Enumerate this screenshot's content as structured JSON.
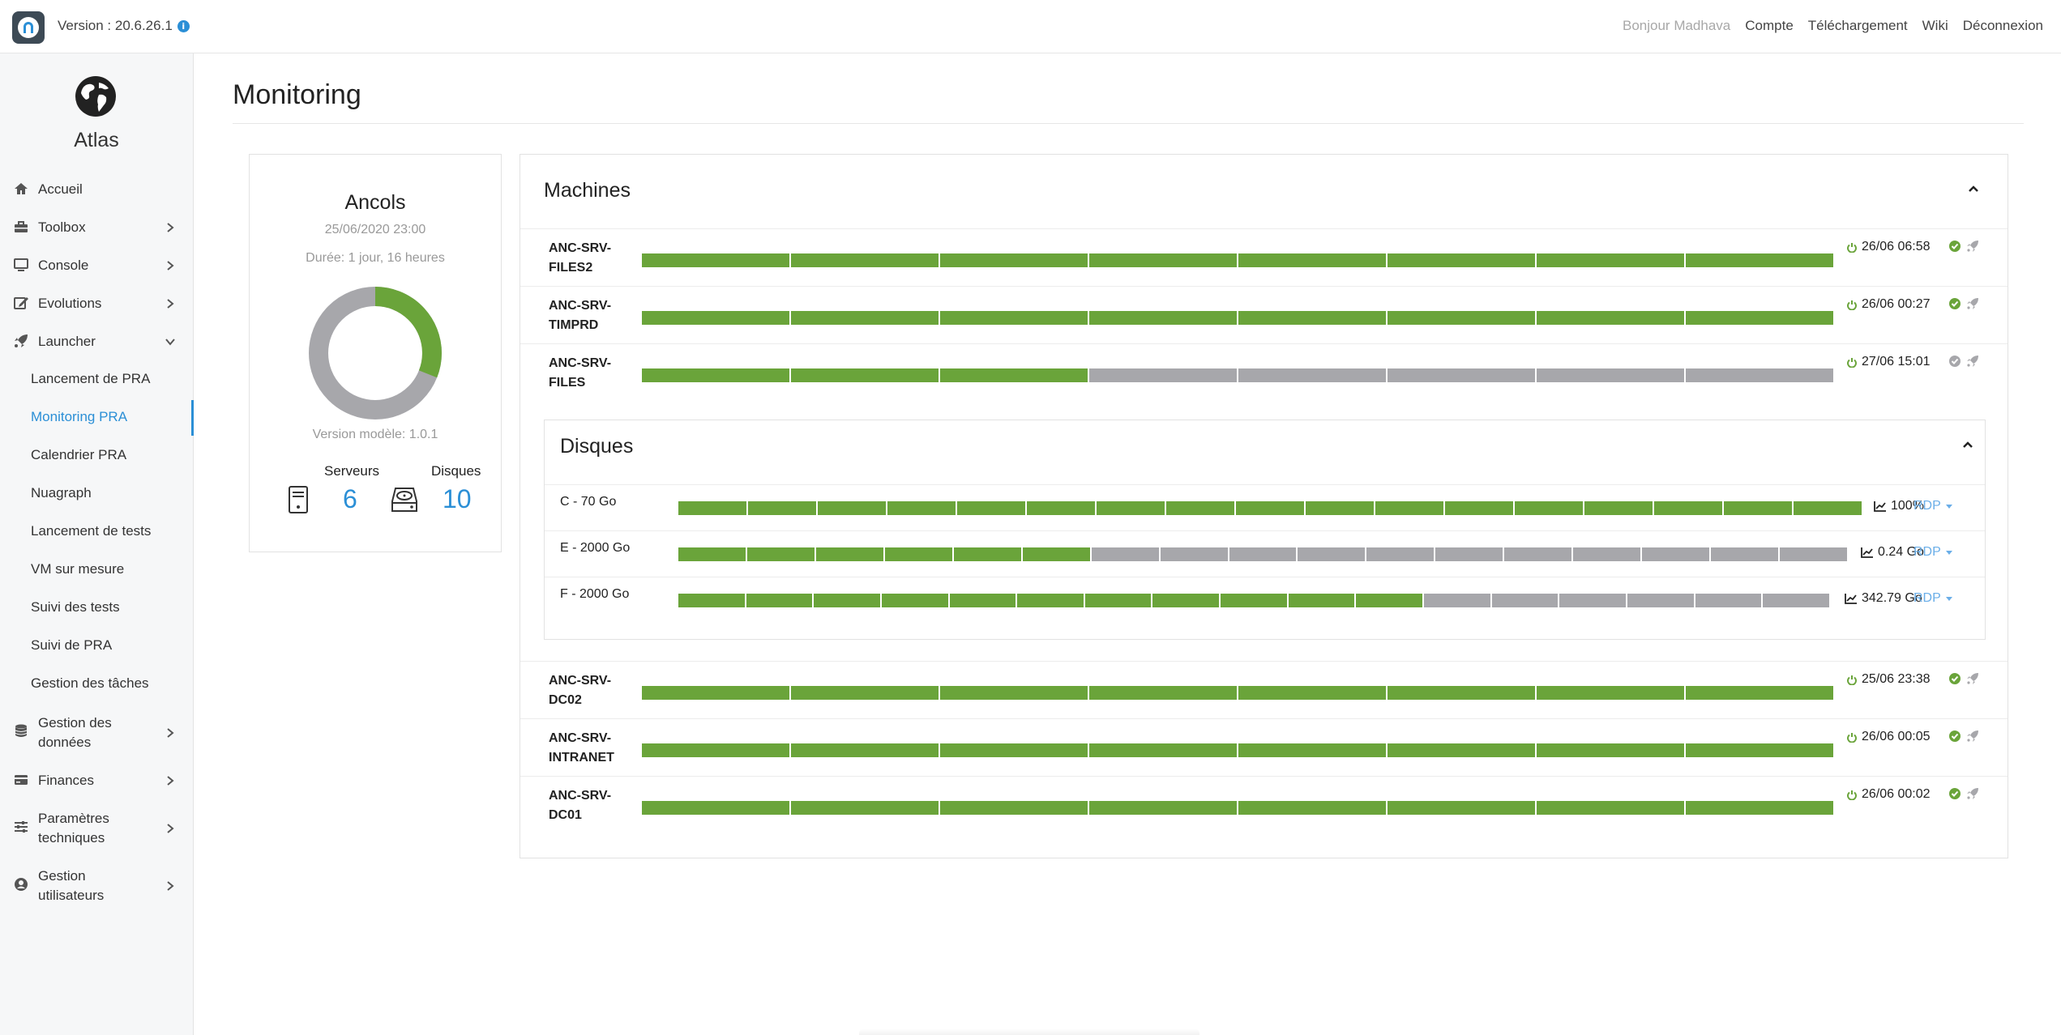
{
  "app": {
    "version": "Version : 20.6.26.1",
    "brand": "Atlas"
  },
  "topnav": {
    "greeting": "Bonjour Madhava",
    "links": [
      "Compte",
      "Téléchargement",
      "Wiki",
      "Déconnexion"
    ]
  },
  "sidebar": {
    "items": [
      {
        "label": "Accueil",
        "icon": "home-icon"
      },
      {
        "label": "Toolbox",
        "icon": "toolbox-icon"
      },
      {
        "label": "Console",
        "icon": "monitor-icon"
      },
      {
        "label": "Evolutions",
        "icon": "edit-icon"
      },
      {
        "label": "Launcher",
        "icon": "rocket-icon"
      },
      {
        "label": "Gestion des données",
        "icon": "database-icon"
      },
      {
        "label": "Finances",
        "icon": "credit-card-icon"
      },
      {
        "label": "Paramètres techniques",
        "icon": "sliders-icon"
      },
      {
        "label": "Gestion utilisateurs",
        "icon": "user-circle-icon"
      }
    ],
    "subitems": [
      "Lancement de PRA",
      "Monitoring PRA",
      "Calendrier PRA",
      "Nuagraph",
      "Lancement de tests",
      "VM sur mesure",
      "Suivi des tests",
      "Suivi de PRA",
      "Gestion des tâches"
    ],
    "active_subitem": "Monitoring PRA"
  },
  "page": {
    "title": "Monitoring"
  },
  "summary": {
    "name": "Ancols",
    "date": "25/06/2020 23:00",
    "duration": "Durée: 1 jour, 16 heures",
    "donut_green_fraction": 0.31,
    "model_version": "Version modèle: 1.0.1",
    "servers_label": "Serveurs",
    "servers_count": "6",
    "disks_label": "Disques",
    "disks_count": "10"
  },
  "machines_section": {
    "title": "Machines",
    "rows": [
      {
        "name": "ANC-SRV-FILES2",
        "segments_total": 8,
        "segments_ok": 8,
        "time": "26/06 06:58",
        "status": "ok"
      },
      {
        "name": "ANC-SRV-TIMPRD",
        "segments_total": 8,
        "segments_ok": 8,
        "time": "26/06 00:27",
        "status": "ok"
      },
      {
        "name": "ANC-SRV-FILES",
        "segments_total": 8,
        "segments_ok": 3,
        "time": "27/06 15:01",
        "status": "pending"
      }
    ],
    "rows_after": [
      {
        "name": "ANC-SRV-DC02",
        "segments_total": 8,
        "segments_ok": 8,
        "time": "25/06 23:38",
        "status": "ok"
      },
      {
        "name": "ANC-SRV-INTRANET",
        "segments_total": 8,
        "segments_ok": 8,
        "time": "26/06 00:05",
        "status": "ok"
      },
      {
        "name": "ANC-SRV-DC01",
        "segments_total": 8,
        "segments_ok": 8,
        "time": "26/06 00:02",
        "status": "ok"
      }
    ]
  },
  "disks_section": {
    "title": "Disques",
    "rows": [
      {
        "name": "C - 70 Go",
        "segments_total": 17,
        "segments_ok": 17,
        "value": "100%",
        "action": "RDP"
      },
      {
        "name": "E - 2000 Go",
        "segments_total": 17,
        "segments_ok": 6,
        "value": "0.24 Go",
        "action": "RDP"
      },
      {
        "name": "F - 2000 Go",
        "segments_total": 17,
        "segments_ok": 11,
        "value": "342.79 Go",
        "action": "RDP"
      }
    ]
  },
  "colors": {
    "accent": "#2b8fd6",
    "ok": "#6aa43a",
    "pending": "#a7a7ab"
  }
}
